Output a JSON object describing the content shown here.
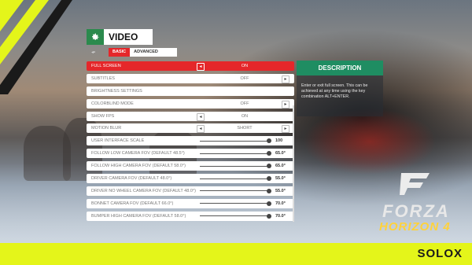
{
  "header": {
    "title": "VIDEO",
    "icon": "gear-icon"
  },
  "tabs": {
    "prev_icon": "bumper-left-icon",
    "items": [
      {
        "label": "BASIC",
        "active": true
      },
      {
        "label": "ADVANCED",
        "active": false
      }
    ]
  },
  "settings": [
    {
      "label": "FULL SCREEN",
      "value": "ON",
      "type": "toggle-left",
      "selected": true
    },
    {
      "label": "SUBTITLES",
      "value": "OFF",
      "type": "toggle-right"
    },
    {
      "label": "BRIGHTNESS SETTINGS",
      "value": "",
      "type": "button"
    },
    {
      "label": "COLORBLIND MODE",
      "value": "OFF",
      "type": "toggle-right"
    },
    {
      "label": "SHOW FPS",
      "value": "ON",
      "type": "toggle-left"
    },
    {
      "label": "MOTION BLUR",
      "value": "SHORT",
      "type": "toggle-both"
    },
    {
      "label": "USER INTERFACE SCALE",
      "value": "100",
      "type": "slider",
      "level": 1.0
    },
    {
      "label": "FOLLOW LOW CAMERA FOV (DEFAULT 48.5°)",
      "value": "65.0°",
      "type": "slider",
      "level": 1.0
    },
    {
      "label": "FOLLOW HIGH CAMERA FOV (DEFAULT 58.0°)",
      "value": "65.0°",
      "type": "slider",
      "level": 1.0
    },
    {
      "label": "DRIVER CAMERA FOV (DEFAULT 48.0°)",
      "value": "55.0°",
      "type": "slider",
      "level": 1.0
    },
    {
      "label": "DRIVER NO WHEEL CAMERA FOV (DEFAULT 48.0°)",
      "value": "55.0°",
      "type": "slider",
      "level": 1.0
    },
    {
      "label": "BONNET CAMERA FOV (DEFAULT 66.0°)",
      "value": "70.0°",
      "type": "slider",
      "level": 1.0
    },
    {
      "label": "BUMPER HIGH CAMERA FOV (DEFAULT 58.0°)",
      "value": "70.0°",
      "type": "slider",
      "level": 1.0
    }
  ],
  "description": {
    "title": "DESCRIPTION",
    "text": "Enter or exit full screen. This can be achieved at any time using the key combination ALT+ENTER."
  },
  "branding": {
    "game_word1": "FORZA",
    "game_word2": "HORIZON 4",
    "watermark": "SOLOX"
  },
  "colors": {
    "accent_red": "#e5272a",
    "accent_green": "#1f8d62",
    "yellow_bar": "#e4f51a"
  }
}
